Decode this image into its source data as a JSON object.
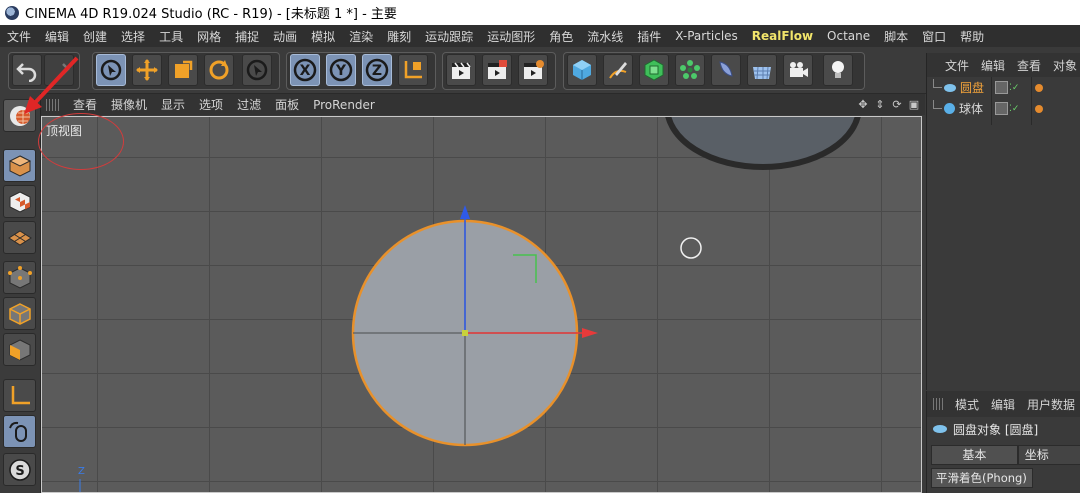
{
  "window": {
    "title": "CINEMA 4D R19.024 Studio (RC - R19) - [未标题 1 *] - 主要"
  },
  "menubar": {
    "items": [
      "文件",
      "编辑",
      "创建",
      "选择",
      "工具",
      "网格",
      "捕捉",
      "动画",
      "模拟",
      "渲染",
      "雕刻",
      "运动跟踪",
      "运动图形",
      "角色",
      "流水线",
      "插件",
      "X-Particles",
      "RealFlow",
      "Octane",
      "脚本",
      "窗口",
      "帮助"
    ],
    "highlight_index": 17,
    "highlight_color": "#f2e56b"
  },
  "toolbar": {
    "groups": [
      "undo-redo",
      "selection-transform",
      "axis-lock",
      "render",
      "create-objects"
    ],
    "axis_labels": [
      "X",
      "Y",
      "Z"
    ]
  },
  "viewport": {
    "menu": [
      "查看",
      "摄像机",
      "显示",
      "选项",
      "过滤",
      "面板",
      "ProRender"
    ],
    "label": "顶视图",
    "axis_label": "Z",
    "selection_color": "#e8912b"
  },
  "object_manager": {
    "menu": [
      "文件",
      "编辑",
      "查看",
      "对象"
    ],
    "objects": [
      {
        "name": "圆盘",
        "active": true
      },
      {
        "name": "球体",
        "active": false
      }
    ]
  },
  "attribute_manager": {
    "menu": [
      "模式",
      "编辑",
      "用户数据"
    ],
    "object_title": "圆盘对象 [圆盘]",
    "tabs": [
      "基本",
      "坐标"
    ],
    "tag_label": "平滑着色(Phong)"
  },
  "annotation": {
    "color": "#d23c3c"
  }
}
